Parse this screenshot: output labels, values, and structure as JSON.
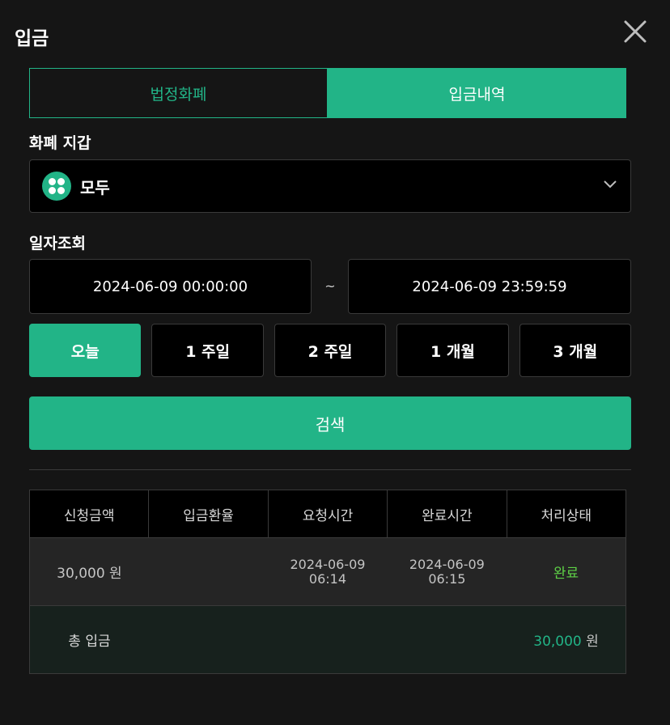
{
  "modal": {
    "title": "입금"
  },
  "tabs": [
    {
      "label": "법정화폐",
      "active": false
    },
    {
      "label": "입금내역",
      "active": true
    }
  ],
  "wallet": {
    "label": "화폐 지갑",
    "selected": "모두",
    "icon": "grid-dots-icon"
  },
  "date_query": {
    "label": "일자조회",
    "start": "2024-06-09 00:00:00",
    "separator": "~",
    "end": "2024-06-09 23:59:59"
  },
  "periods": [
    {
      "label": "오늘",
      "active": true
    },
    {
      "label": "1 주일",
      "active": false
    },
    {
      "label": "2 주일",
      "active": false
    },
    {
      "label": "1 개월",
      "active": false
    },
    {
      "label": "3 개월",
      "active": false
    }
  ],
  "search_label": "검색",
  "table": {
    "headers": [
      "신청금액",
      "입금환율",
      "요청시간",
      "완료시간",
      "처리상태"
    ],
    "rows": [
      {
        "amount": "30,000 원",
        "rate": "",
        "requested_date": "2024-06-09",
        "requested_time": "06:14",
        "completed_date": "2024-06-09",
        "completed_time": "06:15",
        "status": "완료"
      }
    ],
    "total": {
      "label": "총 입금",
      "amount": "30,000",
      "unit": " 원"
    }
  },
  "colors": {
    "accent": "#22b487",
    "background": "#151515",
    "status_done": "#5ed146"
  }
}
